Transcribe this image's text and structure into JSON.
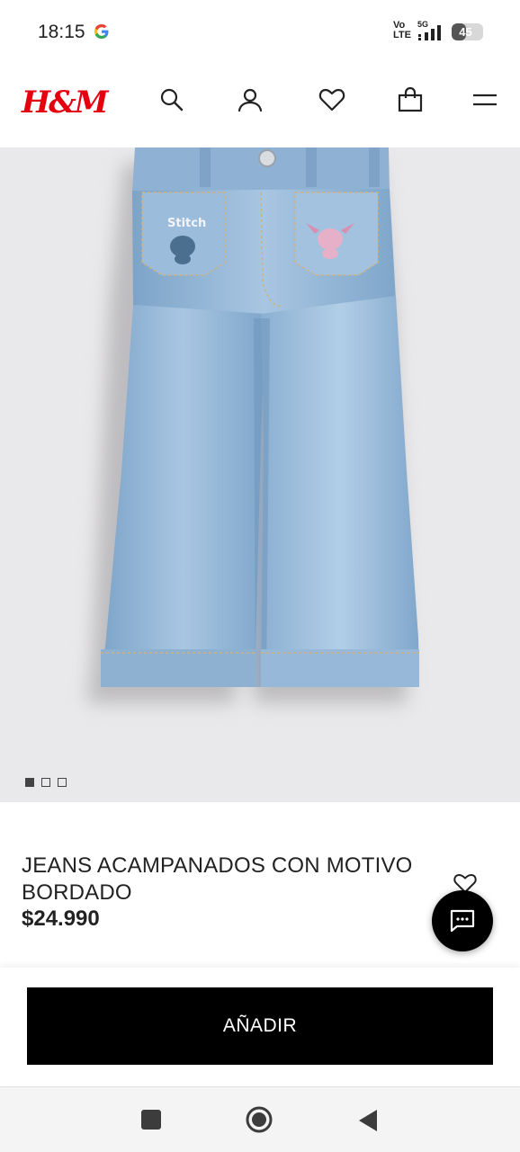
{
  "status_bar": {
    "time": "18:15",
    "volte_top": "Vo",
    "volte_bottom": "LTE",
    "network": "5G",
    "battery": "45",
    "battery_level_percent": 45
  },
  "header": {
    "logo": "H&M",
    "icons": [
      "search-icon",
      "account-icon",
      "favorites-icon",
      "shopping-bag-icon",
      "menu-icon"
    ]
  },
  "product": {
    "image_description_icon": "jeans-image",
    "carousel_total": 3,
    "carousel_active": 1,
    "title": "JEANS ACAMPANADOS CON MOTIVO BORDADO",
    "price": "$24.990",
    "embroidery_text": "Stitch"
  },
  "actions": {
    "add_label": "AÑADIR"
  },
  "colors": {
    "brand": "#e50010",
    "button": "#000000",
    "denim": "#8fb3d4",
    "image_bg": "#e9e8ea"
  }
}
